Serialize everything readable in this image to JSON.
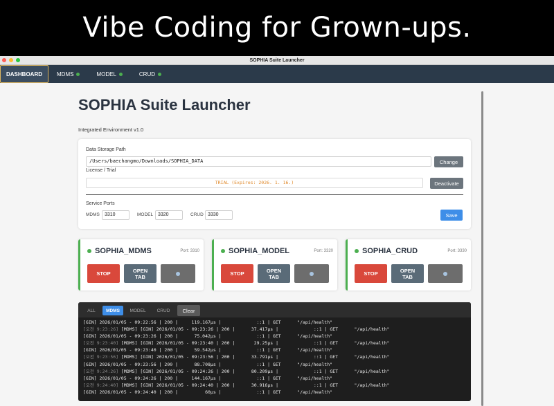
{
  "banner": {
    "text": "Vibe Coding for Grown-ups."
  },
  "window": {
    "title": "SOPHIA Suite Launcher"
  },
  "nav": {
    "items": [
      {
        "label": "DASHBOARD",
        "active": true,
        "status": false
      },
      {
        "label": "MDMS",
        "active": false,
        "status": true
      },
      {
        "label": "MODEL",
        "active": false,
        "status": true
      },
      {
        "label": "CRUD",
        "active": false,
        "status": true
      }
    ]
  },
  "page": {
    "title": "SOPHIA Suite Launcher",
    "subtitle": "Integrated Environment v1.0"
  },
  "settings": {
    "storage_label": "Data Storage Path",
    "storage_path": "/Users/baechangmo/Downloads/SOPHIA_DATA",
    "change_label": "Change",
    "license_label": "License / Trial",
    "trial_text": "TRIAL (Expires: 2026. 1. 16.)",
    "deactivate_label": "Deactivate",
    "ports_label": "Service Ports",
    "ports": [
      {
        "name": "MDMS",
        "value": "3310"
      },
      {
        "name": "MODEL",
        "value": "3320"
      },
      {
        "name": "CRUD",
        "value": "3330"
      }
    ],
    "save_label": "Save"
  },
  "services": [
    {
      "name": "SOPHIA_MDMS",
      "port": "Port: 3310",
      "stop": "STOP",
      "open": "OPEN\nTAB"
    },
    {
      "name": "SOPHIA_MODEL",
      "port": "Port: 3320",
      "stop": "STOP",
      "open": "OPEN\nTAB"
    },
    {
      "name": "SOPHIA_CRUD",
      "port": "Port: 3330",
      "stop": "STOP",
      "open": "OPEN\nTAB"
    }
  ],
  "logs": {
    "tabs": [
      "ALL",
      "MDMS",
      "MODEL",
      "CRUD"
    ],
    "active_tab": "MDMS",
    "clear_label": "Clear",
    "lines": [
      {
        "prefix": "",
        "text": "[GIN] 2026/01/05 - 09:22:56 | 200 |     119.167µs |             ::1 | GET      \"/api/health\""
      },
      {
        "prefix": "[오전 9:23:26] ",
        "text": "[MDMS] [GIN] 2026/01/05 - 09:23:26 | 200 |      37.417µs |             ::1 | GET      \"/api/health\""
      },
      {
        "prefix": "",
        "text": "[GIN] 2026/01/05 - 09:23:26 | 200 |      75.042µs |             ::1 | GET      \"/api/health\""
      },
      {
        "prefix": "[오전 9:23:40] ",
        "text": "[MDMS] [GIN] 2026/01/05 - 09:23:40 | 200 |       29.25µs |             ::1 | GET      \"/api/health\""
      },
      {
        "prefix": "",
        "text": "[GIN] 2026/01/05 - 09:23:40 | 200 |      59.542µs |             ::1 | GET      \"/api/health\""
      },
      {
        "prefix": "[오전 9:23:56] ",
        "text": "[MDMS] [GIN] 2026/01/05 - 09:23:56 | 200 |      33.791µs |             ::1 | GET      \"/api/health\""
      },
      {
        "prefix": "",
        "text": "[GIN] 2026/01/05 - 09:23:56 | 200 |      88.708µs |             ::1 | GET      \"/api/health\""
      },
      {
        "prefix": "[오전 9:24:26] ",
        "text": "[MDMS] [GIN] 2026/01/05 - 09:24:26 | 200 |      80.209µs |             ::1 | GET      \"/api/health\""
      },
      {
        "prefix": "",
        "text": "[GIN] 2026/01/05 - 09:24:26 | 200 |     144.167µs |             ::1 | GET      \"/api/health\""
      },
      {
        "prefix": "[오전 9:24:40] ",
        "text": "[MDMS] [GIN] 2026/01/05 - 09:24:40 | 200 |      30.916µs |             ::1 | GET      \"/api/health\""
      },
      {
        "prefix": "",
        "text": "[GIN] 2026/01/05 - 09:24:40 | 200 |          60µs |             ::1 | GET      \"/api/health\""
      }
    ]
  },
  "colors": {
    "navbar": "#2b3a4a",
    "status_green": "#4caf50",
    "stop_red": "#d9483b",
    "primary_blue": "#3e8ee8",
    "trial_orange": "#e08a2c"
  }
}
